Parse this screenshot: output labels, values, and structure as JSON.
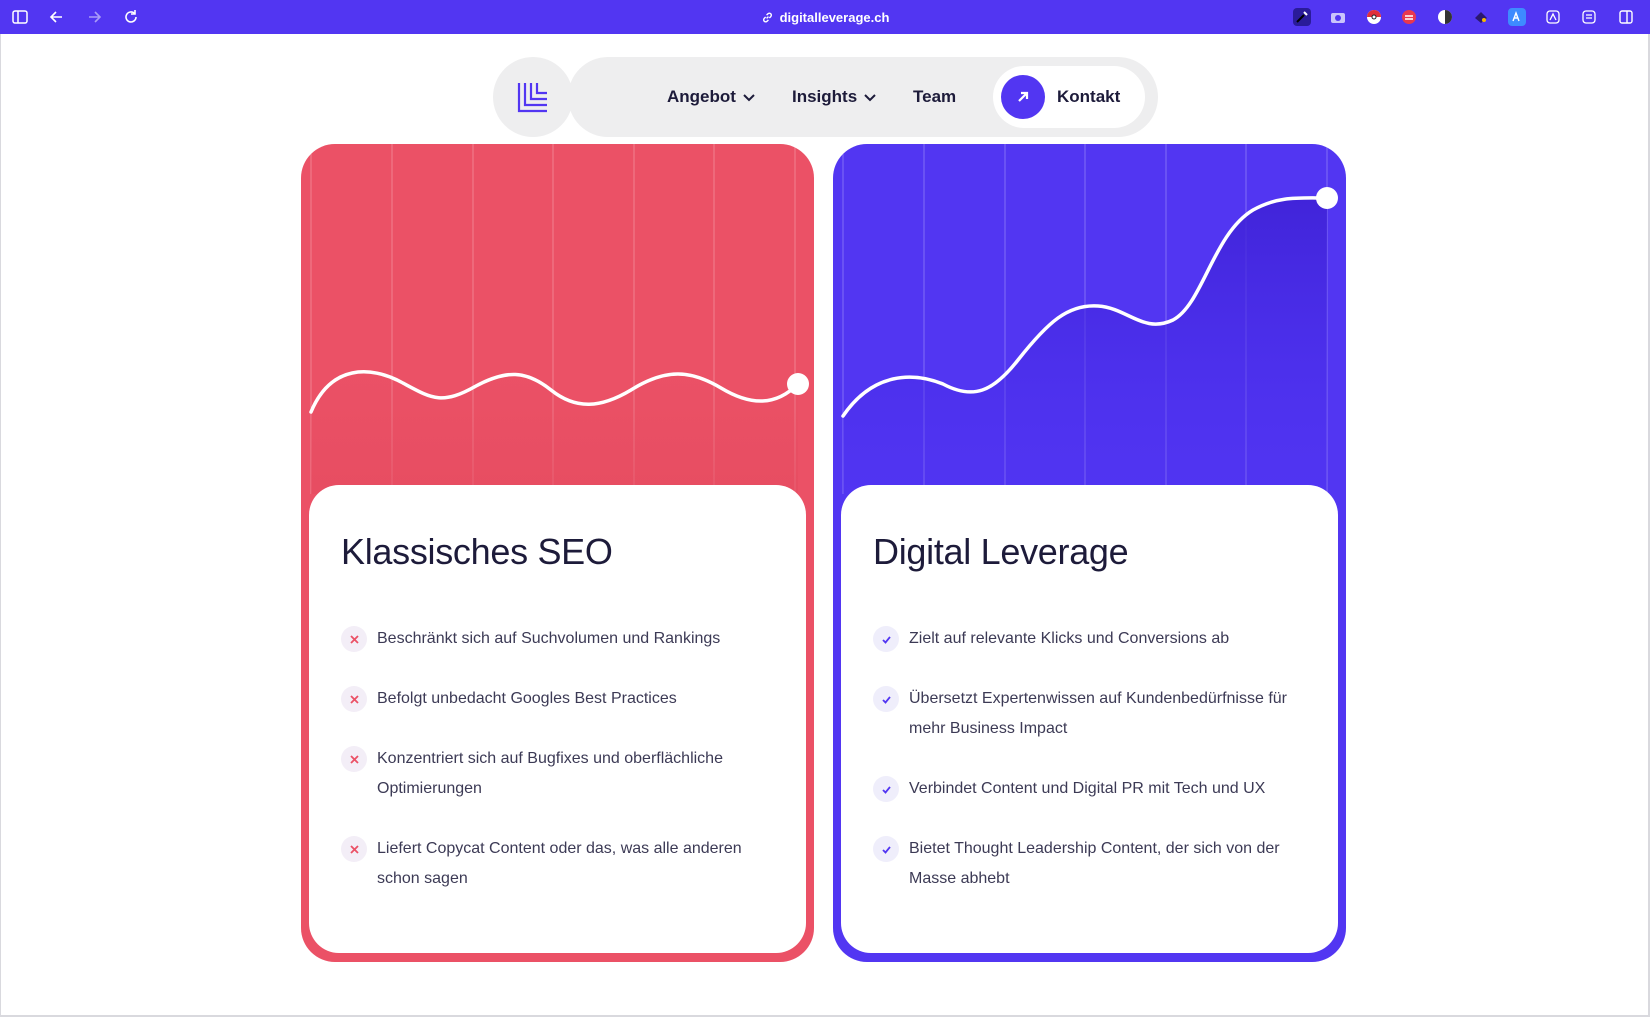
{
  "browser": {
    "url": "digitalleverage.ch",
    "accent": "#5236f2"
  },
  "nav": {
    "items": [
      {
        "label": "Angebot",
        "has_dropdown": true
      },
      {
        "label": "Insights",
        "has_dropdown": true
      },
      {
        "label": "Team",
        "has_dropdown": false
      }
    ],
    "contact_label": "Kontakt"
  },
  "cards": {
    "seo": {
      "title": "Klassisches SEO",
      "color": "#eb5166",
      "items": [
        "Beschränkt sich auf Suchvolumen und Rankings",
        "Befolgt unbedacht Googles Best Practices",
        "Konzentriert sich auf Bugfixes und oberflächliche Optimierungen",
        "Liefert Copycat Content oder das, was alle anderen schon sagen"
      ]
    },
    "dl": {
      "title": "Digital Leverage",
      "color": "#5236f2",
      "items": [
        "Zielt auf relevante Klicks und Conversions ab",
        "Übersetzt Expertenwissen auf Kundenbedürfnisse für mehr Business Impact",
        "Verbindet Content und Digital PR mit Tech und UX",
        "Bietet Thought Leadership Content, der sich von der Masse abhebt"
      ]
    }
  }
}
